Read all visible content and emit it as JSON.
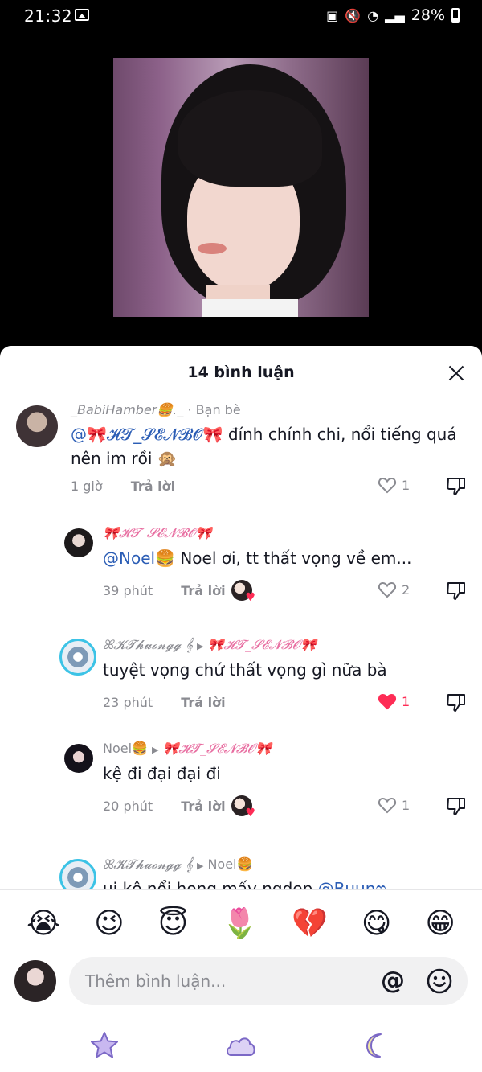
{
  "status_bar": {
    "time": "21:32",
    "battery": "28%"
  },
  "sheet": {
    "title": "14 bình luận"
  },
  "comments": [
    {
      "username": "_BabiHamber🍔._",
      "username_suffix": "· Bạn bè",
      "mention": "@🎀𝓗𝓣_𝓢𝓔𝓝𝓑𝓞🎀",
      "text": " đính chính chi, nổi tiếng quá nên im rồi 🙊",
      "time": "1 giờ",
      "reply_label": "Trả lời",
      "likes": "1",
      "liked": false
    },
    {
      "username": "🎀𝓗𝓣_𝓢𝓔𝓝𝓑𝓞🎀",
      "mention": "@Noel🍔",
      "text": " Noel ơi, tt thất vọng về em...",
      "time": "39 phút",
      "reply_label": "Trả lời",
      "likes": "2",
      "liked": false
    },
    {
      "username": "ꕤ𝓚𝓣𝓱𝓾𝓸𝓷𝓰𝓰 𝄞",
      "reply_to": "🎀𝓗𝓣_𝓢𝓔𝓝𝓑𝓞🎀",
      "text": "tuyệt vọng chứ thất vọng gì nữa bà",
      "time": "23 phút",
      "reply_label": "Trả lời",
      "likes": "1",
      "liked": true
    },
    {
      "username": "Noel🍔",
      "reply_to": "🎀𝓗𝓣_𝓢𝓔𝓝𝓑𝓞🎀",
      "text": "kệ đi đại đại đi",
      "time": "20 phút",
      "reply_label": "Trả lời",
      "likes": "1",
      "liked": false
    },
    {
      "username": "ꕤ𝓚𝓣𝓱𝓾𝓸𝓷𝓰𝓰 𝄞",
      "reply_to": "Noel🍔",
      "text": "ui kệ nổi hong mấy ngdep ",
      "mention": "@Buunෆ"
    }
  ],
  "emoji_bar": [
    "😭",
    "😉",
    "😇",
    "🌷",
    "💔",
    "😋",
    "😁"
  ],
  "input": {
    "placeholder": "Thêm bình luận..."
  },
  "colors": {
    "like_active": "#fe2c55",
    "mention": "#2b5db5",
    "muted": "#8a8b91"
  },
  "icons": [
    "close-icon",
    "heart-icon",
    "dislike-icon",
    "at-icon",
    "smile-icon",
    "star-icon",
    "cloud-icon",
    "moon-icon"
  ]
}
